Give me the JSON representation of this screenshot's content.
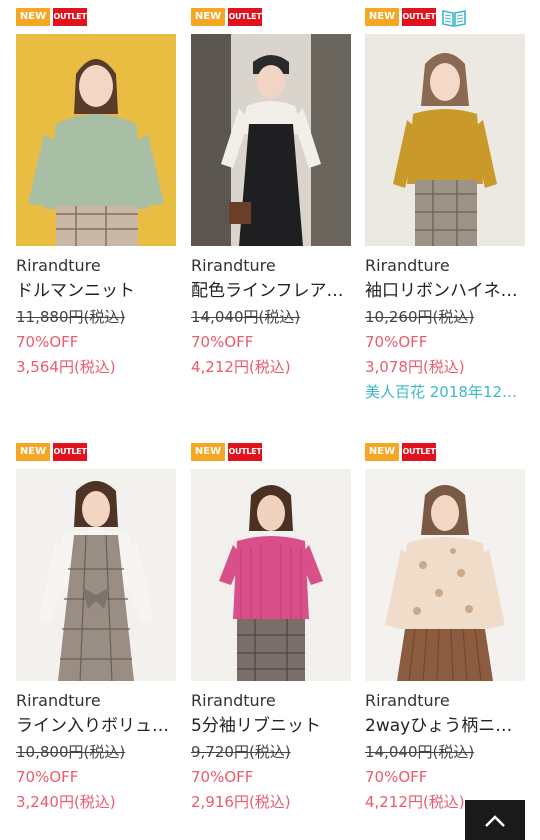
{
  "badges": {
    "new": "NEW",
    "outlet": "OUTLET"
  },
  "products": [
    {
      "brand": "Rirandture",
      "name": "ドルマンニット",
      "original_price": "11,880円(税込)",
      "discount": "70%OFF",
      "price": "3,564円(税込)",
      "magazine": "",
      "badge_icon": ""
    },
    {
      "brand": "Rirandture",
      "name": "配色ラインフレア…",
      "original_price": "14,040円(税込)",
      "discount": "70%OFF",
      "price": "4,212円(税込)",
      "magazine": "",
      "badge_icon": ""
    },
    {
      "brand": "Rirandture",
      "name": "袖口リボンハイネ…",
      "original_price": "10,260円(税込)",
      "discount": "70%OFF",
      "price": "3,078円(税込)",
      "magazine": "美人百花 2018年12…",
      "badge_icon": "book-icon"
    },
    {
      "brand": "Rirandture",
      "name": "ライン入りボリュ…",
      "original_price": "10,800円(税込)",
      "discount": "70%OFF",
      "price": "3,240円(税込)",
      "magazine": "",
      "badge_icon": ""
    },
    {
      "brand": "Rirandture",
      "name": "5分袖リブニット",
      "original_price": "9,720円(税込)",
      "discount": "70%OFF",
      "price": "2,916円(税込)",
      "magazine": "",
      "badge_icon": ""
    },
    {
      "brand": "Rirandture",
      "name": "2wayひょう柄ニ…",
      "original_price": "14,040円(税込)",
      "discount": "70%OFF",
      "price": "4,212円(税込)",
      "magazine": "",
      "badge_icon": ""
    }
  ],
  "scroll_top": {
    "icon": "chevron-up-icon"
  },
  "colors": {
    "accent": "#ec5a6e",
    "new_badge": "#f5a623",
    "outlet_badge": "#e0121d",
    "magazine_link": "#3bb8c9"
  }
}
